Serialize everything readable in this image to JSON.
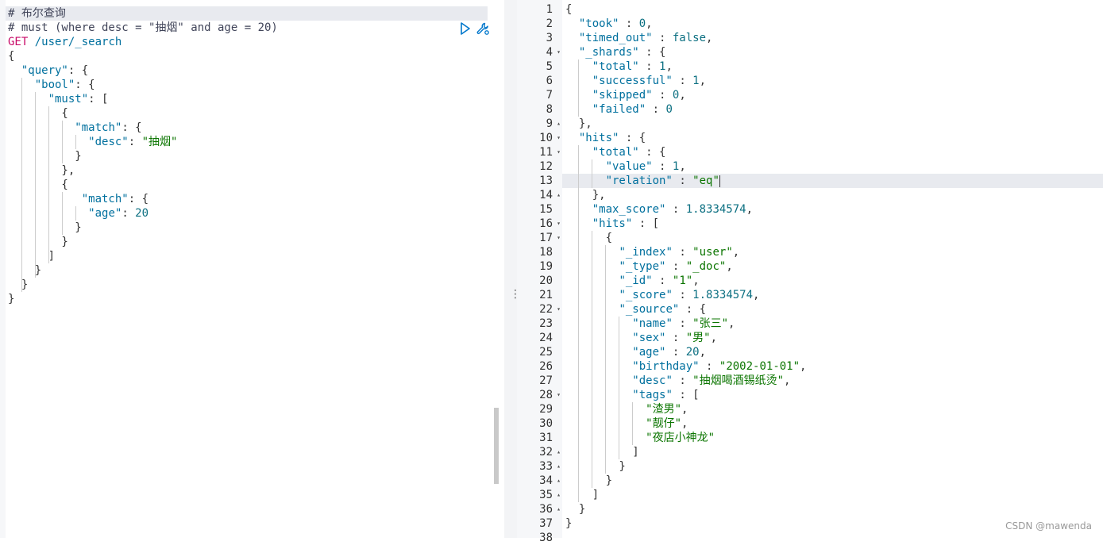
{
  "request": {
    "comment_title": "# 布尔查询",
    "comment_desc": "# must (where desc = \"抽烟\" and age = 20)",
    "method": "GET",
    "url": "/user/_search"
  },
  "response_line_numbers": [
    "1",
    "2",
    "3",
    "4",
    "5",
    "6",
    "7",
    "8",
    "9",
    "10",
    "11",
    "12",
    "13",
    "14",
    "15",
    "16",
    "17",
    "18",
    "19",
    "20",
    "21",
    "22",
    "23",
    "24",
    "25",
    "26",
    "27",
    "28",
    "29",
    "30",
    "31",
    "32",
    "33",
    "34",
    "35",
    "36",
    "37",
    "38"
  ],
  "response": {
    "took": "0",
    "timed_out": "false",
    "total": "1",
    "successful": "1",
    "skipped": "0",
    "failed": "0",
    "hits_total_value": "1",
    "hits_total_relation": "\"eq\"",
    "max_score": "1.8334574",
    "index": "\"user\"",
    "type": "\"_doc\"",
    "id": "\"1\"",
    "score": "1.8334574",
    "source_name": "\"张三\"",
    "source_sex": "\"男\"",
    "source_age": "20",
    "source_birthday": "\"2002-01-01\"",
    "source_desc": "\"抽烟喝酒锡纸烫\"",
    "tag1": "\"渣男\"",
    "tag2": "\"靓仔\"",
    "tag3": "\"夜店小神龙\""
  },
  "query": {
    "desc_value": "\"抽烟\"",
    "age_value": "20"
  },
  "watermark": "CSDN @mawenda",
  "icons": [
    "play-icon",
    "wrench-icon",
    "fold-arrow-icon",
    "drag-handle-icon"
  ]
}
